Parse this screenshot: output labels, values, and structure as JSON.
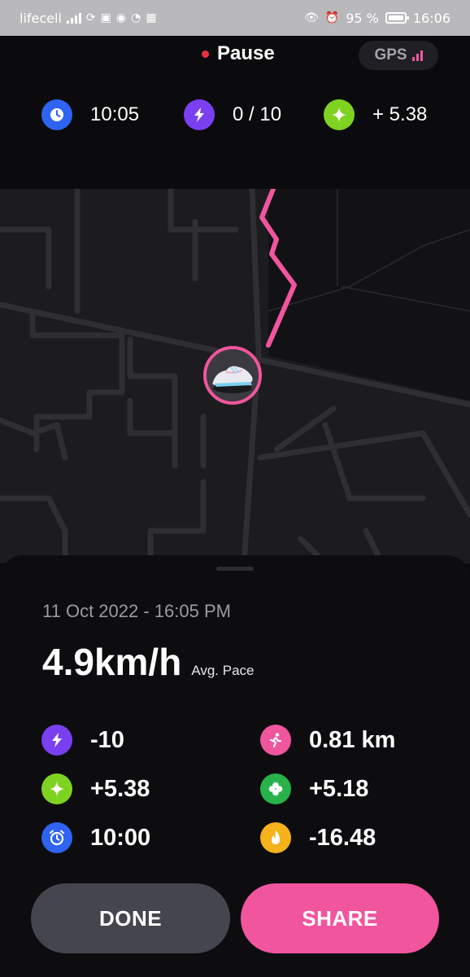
{
  "status_bar": {
    "carrier": "lifecell",
    "battery": "95 %",
    "time": "16:06"
  },
  "header": {
    "pause_label": "Pause",
    "gps_label": "GPS"
  },
  "stats": [
    {
      "icon": "clock-icon",
      "value": "10:05",
      "color": "#2f63f2"
    },
    {
      "icon": "lightning-icon",
      "value": "0 / 10",
      "color": "#7b3ff2"
    },
    {
      "icon": "sparkle-icon",
      "value": "+ 5.38",
      "color": "#7ed321"
    }
  ],
  "summary": {
    "date": "11 Oct 2022 - 16:05 PM",
    "pace": "4.9km/h",
    "pace_label": "Avg. Pace"
  },
  "metrics": [
    {
      "icon": "lightning-icon",
      "value": "-10",
      "color": "#7b3ff2"
    },
    {
      "icon": "runner-icon",
      "value": "0.81 km",
      "color": "#f1559e"
    },
    {
      "icon": "sparkle-icon",
      "value": "+5.38",
      "color": "#7ed321"
    },
    {
      "icon": "clover-icon",
      "value": "+5.18",
      "color": "#27b24a"
    },
    {
      "icon": "alarm-icon",
      "value": "10:00",
      "color": "#2f63f2"
    },
    {
      "icon": "flame-icon",
      "value": "-16.48",
      "color": "#f6b21b"
    }
  ],
  "buttons": {
    "done": "DONE",
    "share": "SHARE"
  },
  "colors": {
    "accent": "#f1559e",
    "background": "#0b0b0d"
  }
}
